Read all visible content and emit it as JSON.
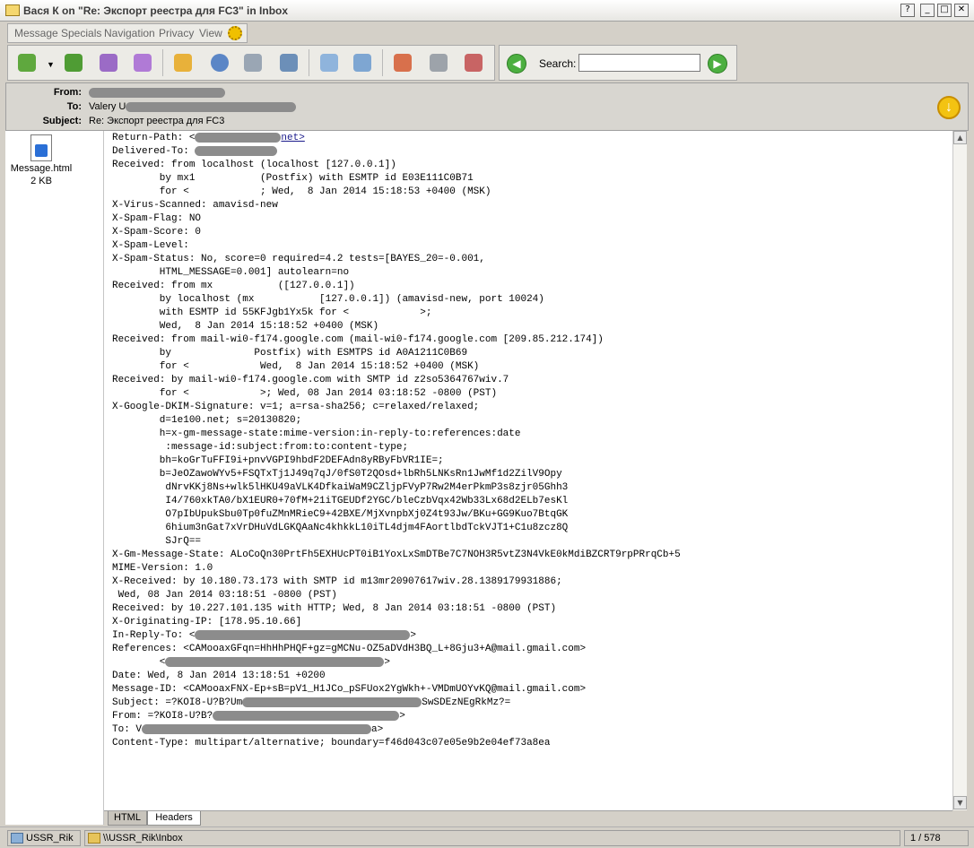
{
  "window": {
    "title": "Вася К on \"Re: Экспорт реестра для FC3\" in Inbox",
    "help_glyph": "?",
    "min_glyph": "_",
    "max_glyph": "□",
    "close_glyph": "✕"
  },
  "menu": [
    "Message",
    "Specials",
    "Navigation",
    "Privacy",
    "View"
  ],
  "toolbar_icons": [
    "reply-icon",
    "reply-all-icon",
    "forward-icon",
    "forward-as-attachment-icon",
    "spellcheck-icon",
    "view-source-icon",
    "print-icon",
    "save-icon",
    "get-mail-icon",
    "send-receive-icon",
    "delete-icon",
    "trash-icon",
    "not-junk-icon"
  ],
  "search": {
    "label": "Search:",
    "value": "",
    "prev_glyph": "◀",
    "next_glyph": "▶"
  },
  "headers": {
    "from_label": "From:",
    "to_label": "To:",
    "to_value": "Valery U",
    "subject_label": "Subject:",
    "subject_value": "Re: Экспорт реестра для FC3",
    "attention_glyph": "↓"
  },
  "attachment": {
    "name": "Message.html",
    "size": "2 KB"
  },
  "body_lines": [
    "Return-Path: <",
    "Delivered-To: ",
    "Received: from localhost (localhost [127.0.0.1])",
    "        by mx1           (Postfix) with ESMTP id E03E111C0B71",
    "        for <            ; Wed,  8 Jan 2014 15:18:53 +0400 (MSK)",
    "X-Virus-Scanned: amavisd-new",
    "X-Spam-Flag: NO",
    "X-Spam-Score: 0",
    "X-Spam-Level:",
    "X-Spam-Status: No, score=0 required=4.2 tests=[BAYES_20=-0.001,",
    "        HTML_MESSAGE=0.001] autolearn=no",
    "Received: from mx           ([127.0.0.1])",
    "        by localhost (mx           [127.0.0.1]) (amavisd-new, port 10024)",
    "        with ESMTP id 55KFJgb1Yx5k for <            >;",
    "        Wed,  8 Jan 2014 15:18:52 +0400 (MSK)",
    "Received: from mail-wi0-f174.google.com (mail-wi0-f174.google.com [209.85.212.174])",
    "        by              Postfix) with ESMTPS id A0A1211C0B69",
    "        for <            Wed,  8 Jan 2014 15:18:52 +0400 (MSK)",
    "Received: by mail-wi0-f174.google.com with SMTP id z2so5364767wiv.7",
    "        for <            >; Wed, 08 Jan 2014 03:18:52 -0800 (PST)",
    "X-Google-DKIM-Signature: v=1; a=rsa-sha256; c=relaxed/relaxed;",
    "        d=1e100.net; s=20130820;",
    "        h=x-gm-message-state:mime-version:in-reply-to:references:date",
    "         :message-id:subject:from:to:content-type;",
    "        bh=koGrTuFFI9i+pnvVGPI9hbdF2DEFAdn8yRByFbVR1IE=;",
    "        b=JeOZawoWYv5+FSQTxTj1J49q7qJ/0fS0T2QOsd+lbRh5LNKsRn1JwMf1d2ZilV9Opy",
    "         dNrvKKj8Ns+wlk5lHKU49aVLK4DfkaiWaM9CZljpFVyP7Rw2M4erPkmP3s8zjr05Ghh3",
    "         I4/760xkTA0/bX1EUR0+70fM+21iTGEUDf2YGC/bleCzbVqx42Wb33Lx68d2ELb7esKl",
    "         O7pIbUpukSbu0Tp0fuZMnMRieC9+42BXE/MjXvnpbXj0Z4t93Jw/BKu+GG9Kuo7BtqGK",
    "         6hium3nGat7xVrDHuVdLGKQAaNc4khkkL10iTL4djm4FAortlbdTckVJT1+C1u8zcz8Q",
    "         SJrQ==",
    "X-Gm-Message-State: ALoCoQn30PrtFh5EXHUcPT0iB1YoxLxSmDTBe7C7NOH3R5vtZ3N4VkE0kMdiBZCRT9rpPRrqCb+5",
    "MIME-Version: 1.0",
    "X-Received: by 10.180.73.173 with SMTP id m13mr20907617wiv.28.1389179931886;",
    " Wed, 08 Jan 2014 03:18:51 -0800 (PST)",
    "Received: by 10.227.101.135 with HTTP; Wed, 8 Jan 2014 03:18:51 -0800 (PST)",
    "X-Originating-IP: [178.95.10.66]",
    "In-Reply-To: <",
    "References: <CAMooaxGFqn=HhHhPHQF+gz=gMCNu-OZ5aDVdH3BQ_L+8Gju3+A@mail.gmail.com>",
    "        <",
    "Date: Wed, 8 Jan 2014 13:18:51 +0200",
    "Message-ID: <CAMooaxFNX-Ep+sB=pV1_H1JCo_pSFUox2YgWkh+-VMDmUOYvKQ@mail.gmail.com>",
    "Subject: =?KOI8-U?B?Um",
    "From: =?KOI8-U?B?",
    "To: V",
    "Content-Type: multipart/alternative; boundary=f46d043c07e05e9b2e04ef73a8ea"
  ],
  "inline_fragments": {
    "return_path_tail": "net>",
    "subject_tail": "SwSDEzNEgRkMz?=",
    "from_tail": ">",
    "to_tail": "a>"
  },
  "tabs": [
    "HTML",
    "Headers"
  ],
  "status": {
    "account": "USSR_Rik",
    "folder": "\\\\USSR_Rik\\Inbox",
    "counter": "1 / 578"
  }
}
